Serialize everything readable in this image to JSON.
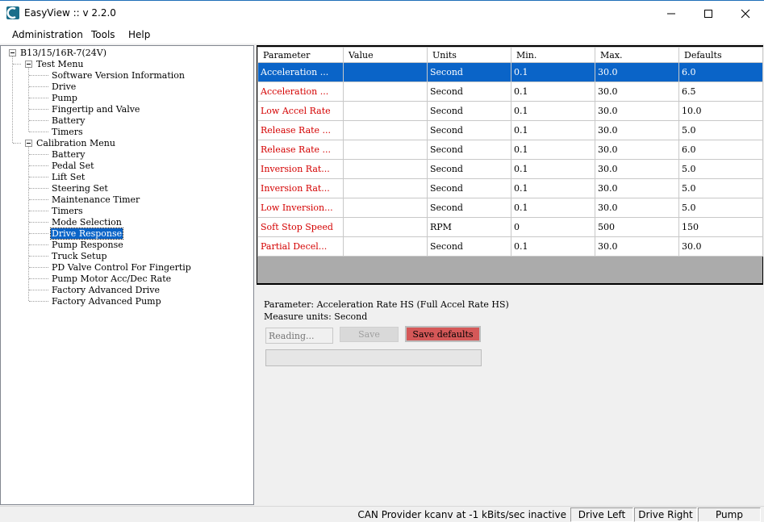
{
  "window": {
    "title": "EasyView :: v 2.2.0"
  },
  "menu": {
    "items": [
      "Administration",
      "Tools",
      "Help"
    ]
  },
  "tree": {
    "root": "B13/15/16R-7(24V)",
    "test_menu": {
      "label": "Test Menu",
      "children": [
        "Software Version Information",
        "Drive",
        "Pump",
        "Fingertip and Valve",
        "Battery",
        "Timers"
      ]
    },
    "calibration_menu": {
      "label": "Calibration Menu",
      "children": [
        "Battery",
        "Pedal Set",
        "Lift Set",
        "Steering Set",
        "Maintenance Timer",
        "Timers",
        "Mode Selection",
        "Drive Response",
        "Pump Response",
        "Truck Setup",
        "PD Valve Control For Fingertip",
        "Pump Motor Acc/Dec Rate",
        "Factory Advanced Drive",
        "Factory Advanced Pump"
      ]
    },
    "selected": "Drive Response"
  },
  "grid": {
    "headers": [
      "Parameter",
      "Value",
      "Units",
      "Min.",
      "Max.",
      "Defaults"
    ],
    "rows": [
      {
        "parameter": "Acceleration ...",
        "value": "",
        "units": "Second",
        "min": "0.1",
        "max": "30.0",
        "defaults": "6.0"
      },
      {
        "parameter": "Acceleration ...",
        "value": "",
        "units": "Second",
        "min": "0.1",
        "max": "30.0",
        "defaults": "6.5"
      },
      {
        "parameter": "Low Accel Rate",
        "value": "",
        "units": "Second",
        "min": "0.1",
        "max": "30.0",
        "defaults": "10.0"
      },
      {
        "parameter": "Release Rate ...",
        "value": "",
        "units": "Second",
        "min": "0.1",
        "max": "30.0",
        "defaults": "5.0"
      },
      {
        "parameter": "Release Rate ...",
        "value": "",
        "units": "Second",
        "min": "0.1",
        "max": "30.0",
        "defaults": "6.0"
      },
      {
        "parameter": "Inversion Rat...",
        "value": "",
        "units": "Second",
        "min": "0.1",
        "max": "30.0",
        "defaults": "5.0"
      },
      {
        "parameter": "Inversion Rat...",
        "value": "",
        "units": "Second",
        "min": "0.1",
        "max": "30.0",
        "defaults": "5.0"
      },
      {
        "parameter": "Low Inversion...",
        "value": "",
        "units": "Second",
        "min": "0.1",
        "max": "30.0",
        "defaults": "5.0"
      },
      {
        "parameter": "Soft Stop Speed",
        "value": "",
        "units": "RPM",
        "min": "0",
        "max": "500",
        "defaults": "150"
      },
      {
        "parameter": "Partial Decel...",
        "value": "",
        "units": "Second",
        "min": "0.1",
        "max": "30.0",
        "defaults": "30.0"
      }
    ],
    "selected_row": 0
  },
  "detail": {
    "parameter_line": "Parameter: Acceleration Rate HS (Full Accel Rate HS)",
    "units_line": "Measure units: Second",
    "value_placeholder": "Reading...",
    "save_label": "Save",
    "save_defaults_label": "Save defaults",
    "progress": 0
  },
  "status": {
    "text": "CAN Provider kcanv at -1 kBits/sec inactive",
    "panels": [
      "Drive Left",
      "Drive Right",
      "Pump"
    ]
  },
  "colors": {
    "selection": "#0a64c8",
    "param_text": "#d40000",
    "save_defaults_bg": "#d55858"
  }
}
